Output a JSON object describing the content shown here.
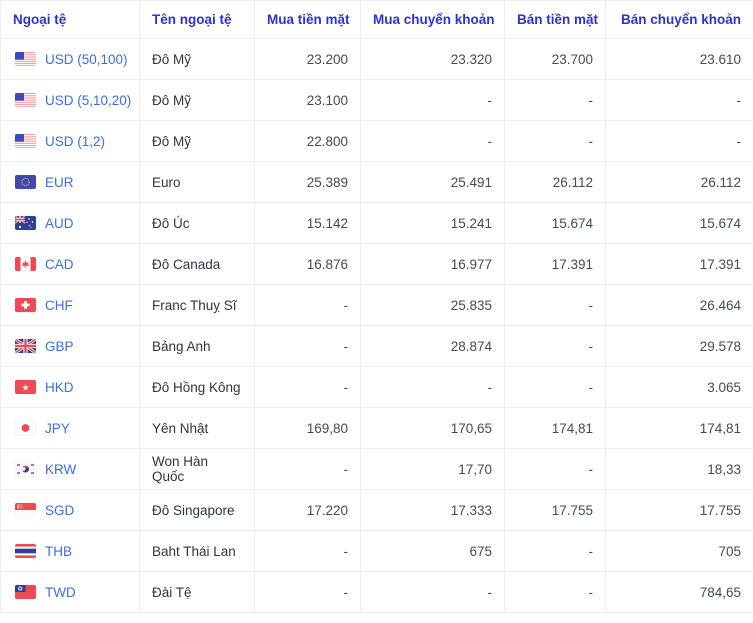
{
  "table": {
    "headers": [
      "Ngoại tệ",
      "Tên ngoại tệ",
      "Mua tiền mặt",
      "Mua chuyển khoản",
      "Bán tiền mặt",
      "Bán chuyển khoản"
    ],
    "header_color": "#2d31d6",
    "code_color": "#3b6fe0",
    "border_color": "#eceef2",
    "rows": [
      {
        "flag": "flag-us-icon",
        "code": "USD (50,100)",
        "name": "Đô Mỹ",
        "buy_cash": "23.200",
        "buy_transfer": "23.320",
        "sell_cash": "23.700",
        "sell_transfer": "23.610"
      },
      {
        "flag": "flag-us-icon",
        "code": "USD (5,10,20)",
        "name": "Đô Mỹ",
        "buy_cash": "23.100",
        "buy_transfer": "-",
        "sell_cash": "-",
        "sell_transfer": "-"
      },
      {
        "flag": "flag-us-icon",
        "code": "USD (1,2)",
        "name": "Đô Mỹ",
        "buy_cash": "22.800",
        "buy_transfer": "-",
        "sell_cash": "-",
        "sell_transfer": "-"
      },
      {
        "flag": "flag-eu-icon",
        "code": "EUR",
        "name": "Euro",
        "buy_cash": "25.389",
        "buy_transfer": "25.491",
        "sell_cash": "26.112",
        "sell_transfer": "26.112"
      },
      {
        "flag": "flag-au-icon",
        "code": "AUD",
        "name": "Đô Úc",
        "buy_cash": "15.142",
        "buy_transfer": "15.241",
        "sell_cash": "15.674",
        "sell_transfer": "15.674"
      },
      {
        "flag": "flag-ca-icon",
        "code": "CAD",
        "name": "Đô Canada",
        "buy_cash": "16.876",
        "buy_transfer": "16.977",
        "sell_cash": "17.391",
        "sell_transfer": "17.391"
      },
      {
        "flag": "flag-ch-icon",
        "code": "CHF",
        "name": "Franc Thuỵ Sĩ",
        "buy_cash": "-",
        "buy_transfer": "25.835",
        "sell_cash": "-",
        "sell_transfer": "26.464"
      },
      {
        "flag": "flag-gb-icon",
        "code": "GBP",
        "name": "Bảng Anh",
        "buy_cash": "-",
        "buy_transfer": "28.874",
        "sell_cash": "-",
        "sell_transfer": "29.578"
      },
      {
        "flag": "flag-hk-icon",
        "code": "HKD",
        "name": "Đô Hồng Kông",
        "buy_cash": "-",
        "buy_transfer": "-",
        "sell_cash": "-",
        "sell_transfer": "3.065"
      },
      {
        "flag": "flag-jp-icon",
        "code": "JPY",
        "name": "Yên Nhật",
        "buy_cash": "169,80",
        "buy_transfer": "170,65",
        "sell_cash": "174,81",
        "sell_transfer": "174,81"
      },
      {
        "flag": "flag-kr-icon",
        "code": "KRW",
        "name": "Won Hàn Quốc",
        "buy_cash": "-",
        "buy_transfer": "17,70",
        "sell_cash": "-",
        "sell_transfer": "18,33"
      },
      {
        "flag": "flag-sg-icon",
        "code": "SGD",
        "name": "Đô Singapore",
        "buy_cash": "17.220",
        "buy_transfer": "17.333",
        "sell_cash": "17.755",
        "sell_transfer": "17.755"
      },
      {
        "flag": "flag-th-icon",
        "code": "THB",
        "name": "Baht Thái Lan",
        "buy_cash": "-",
        "buy_transfer": "675",
        "sell_cash": "-",
        "sell_transfer": "705"
      },
      {
        "flag": "flag-tw-icon",
        "code": "TWD",
        "name": "Đài Tệ",
        "buy_cash": "-",
        "buy_transfer": "-",
        "sell_cash": "-",
        "sell_transfer": "784,65"
      }
    ]
  }
}
